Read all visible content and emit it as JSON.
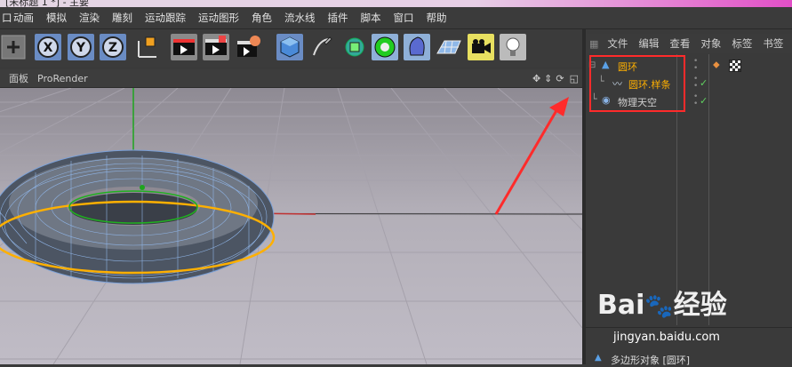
{
  "title_bar": {
    "text": "[未标题 1 *] - 主要"
  },
  "menu": [
    "",
    "动画",
    "模拟",
    "渲染",
    "雕刻",
    "运动跟踪",
    "运动图形",
    "角色",
    "流水线",
    "插件",
    "脚本",
    "窗口",
    "帮助"
  ],
  "toolbar": {
    "axis_x": "X",
    "axis_y": "Y",
    "axis_z": "Z"
  },
  "panel_bar": {
    "tab1": "面板",
    "tab2": "ProRender"
  },
  "right_tabs": [
    "文件",
    "编辑",
    "查看",
    "对象",
    "标签",
    "书签"
  ],
  "objects": [
    {
      "name": "圆环",
      "highlighted": true
    },
    {
      "name": "圆环.样条",
      "highlighted": true
    },
    {
      "name": "物理天空",
      "highlighted": false
    }
  ],
  "attributes": {
    "label": "多边形对象 [圆环]"
  },
  "watermark": {
    "brand": "Bai",
    "brand2": "经验",
    "url": "jingyan.baidu.com"
  },
  "colors": {
    "accent_orange": "#ffb000",
    "check_green": "#60d060",
    "annotation_red": "#ff2b2b"
  }
}
